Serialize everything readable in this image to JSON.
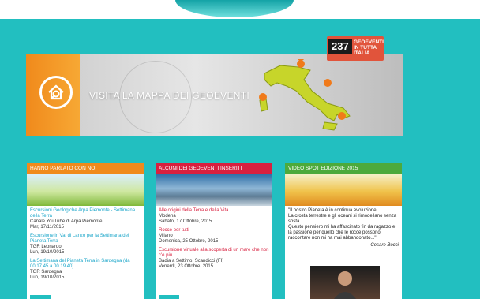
{
  "banner": {
    "title": "VISITA LA MAPPA DEI GEOEVENTI",
    "badge_count": "237",
    "badge_lines": [
      "GEOEVENTI",
      "IN TUTTA",
      "ITALIA"
    ]
  },
  "col1": {
    "header": "HANNO PARLATO CON NOI",
    "items": [
      {
        "link": "Escursioni Geologiche Arpa Piemonte - Settimana della Terra",
        "source": "Canale YouTube di Arpa Piemonte",
        "date": "Mar, 17/11/2015"
      },
      {
        "link": "Escursione in Val di Lanzo per la Settimana del Pianeta Terra",
        "source": "TGR Leonardo",
        "date": "Lun, 19/10/2015"
      },
      {
        "link": "La Settimana del Pianeta Terra in Sardegna (da 00.17.45 a 00.19.40)",
        "source": "TGR Sardegna",
        "date": "Lun, 19/10/2015"
      }
    ]
  },
  "col2": {
    "header": "ALCUNI DEI GEOEVENTI INSERITI",
    "items": [
      {
        "link": "Alle origini della Terra e della Vita",
        "place": "Modena",
        "date": "Sabato, 17 Ottobre, 2015"
      },
      {
        "link": "Rocce per tutti",
        "place": "Milano",
        "date": "Domenica, 25 Ottobre, 2015"
      },
      {
        "link": "Escursione virtuale alla scoperta di un mare che non c'è più",
        "place": "Badia a Settimo, Scandicci (FI)",
        "date": "Venerdì, 23 Ottobre, 2015"
      }
    ]
  },
  "col3": {
    "header": "VIDEO SPOT EDIZIONE 2015",
    "quote_lines": [
      "\"Il nostro Pianeta è in continua evoluzione.",
      "La crosta terrestre e gli oceani si rimodellano senza sosta.",
      "Questo pensiero mi ha affascinato fin da ragazzo e la passione per quello che le rocce possono raccontare non mi ha mai abbandonato...\""
    ],
    "author": "Cesare Bocci"
  },
  "colors": {
    "teal": "#22bfc0",
    "orange": "#f08a1c",
    "red": "#d8203f",
    "green": "#4caa3c"
  }
}
